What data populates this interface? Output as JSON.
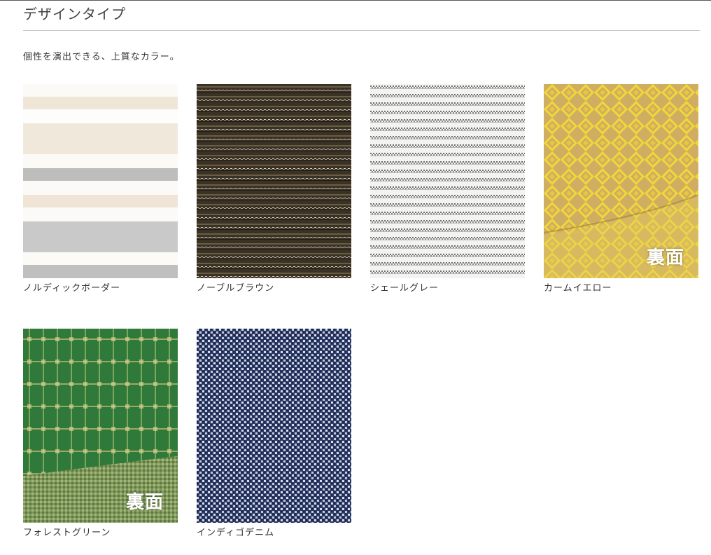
{
  "section": {
    "title": "デザインタイプ",
    "lead": "個性を演出できる、上質なカラー。"
  },
  "swatches": [
    {
      "name": "ノルディックボーダー",
      "pattern": "nordic-border-stripes",
      "badge": ""
    },
    {
      "name": "ノーブルブラウン",
      "pattern": "noble-brown-pinstripe",
      "badge": ""
    },
    {
      "name": "シェールグレー",
      "pattern": "shale-gray-stripes",
      "badge": ""
    },
    {
      "name": "カームイエロー",
      "pattern": "calm-yellow-diamond",
      "badge": "裏面"
    },
    {
      "name": "フォレストグリーン",
      "pattern": "forest-green-check",
      "badge": "裏面"
    },
    {
      "name": "インディゴデニム",
      "pattern": "indigo-denim-weave",
      "badge": ""
    }
  ],
  "colors": {
    "nordic_cream": "#efe6d8",
    "nordic_gray": "#c3c3c3",
    "noble_brown": "#3f3628",
    "shale_gray": "#e4e4e4",
    "calm_yellow": "#d7b84c",
    "forest_green": "#2f7a3a",
    "indigo_denim": "#2e3d68"
  }
}
